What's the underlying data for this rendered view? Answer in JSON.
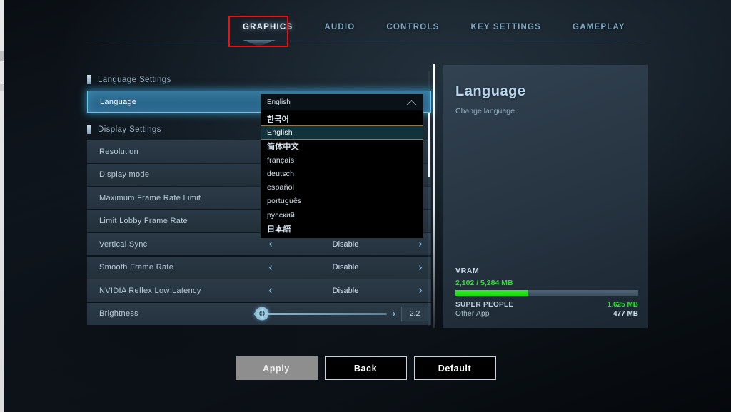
{
  "tabs": [
    {
      "label": "GRAPHICS",
      "active": true
    },
    {
      "label": "AUDIO",
      "active": false
    },
    {
      "label": "CONTROLS",
      "active": false
    },
    {
      "label": "KEY SETTINGS",
      "active": false
    },
    {
      "label": "GAMEPLAY",
      "active": false
    }
  ],
  "sections": {
    "language": {
      "header": "Language Settings",
      "row_label": "Language"
    },
    "display": {
      "header": "Display Settings",
      "rows": [
        {
          "label": "Resolution",
          "value": ""
        },
        {
          "label": "Display mode",
          "value": ""
        },
        {
          "label": "Maximum Frame Rate Limit",
          "value": ""
        },
        {
          "label": "Limit Lobby Frame Rate",
          "value": ""
        },
        {
          "label": "Vertical Sync",
          "value": "Disable"
        },
        {
          "label": "Smooth Frame Rate",
          "value": "Disable"
        },
        {
          "label": "NVIDIA Reflex Low Latency",
          "value": "Disable"
        }
      ],
      "brightness": {
        "label": "Brightness",
        "value": "2.2"
      }
    }
  },
  "dropdown": {
    "selected": "English",
    "options": [
      {
        "label": "한국어",
        "cjk": true,
        "selected": false
      },
      {
        "label": "English",
        "cjk": false,
        "selected": true
      },
      {
        "label": "简体中文",
        "cjk": true,
        "selected": false
      },
      {
        "label": "français",
        "cjk": false,
        "selected": false
      },
      {
        "label": "deutsch",
        "cjk": false,
        "selected": false
      },
      {
        "label": "español",
        "cjk": false,
        "selected": false
      },
      {
        "label": "português",
        "cjk": false,
        "selected": false
      },
      {
        "label": "русский",
        "cjk": false,
        "selected": false
      },
      {
        "label": "日本語",
        "cjk": true,
        "selected": false
      }
    ]
  },
  "info": {
    "title": "Language",
    "description": "Change language.",
    "vram": {
      "title": "VRAM",
      "amount": "2,102 / 5,284 MB",
      "percent": 40,
      "app_label": "SUPER PEOPLE",
      "app_value": "1,625 MB",
      "other_label": "Other App",
      "other_value": "477 MB",
      "fill_color": "#33ee22"
    }
  },
  "footer": {
    "apply": "Apply",
    "back": "Back",
    "default": "Default"
  },
  "icons": {
    "left_arrow": "‹",
    "right_arrow": "›"
  }
}
